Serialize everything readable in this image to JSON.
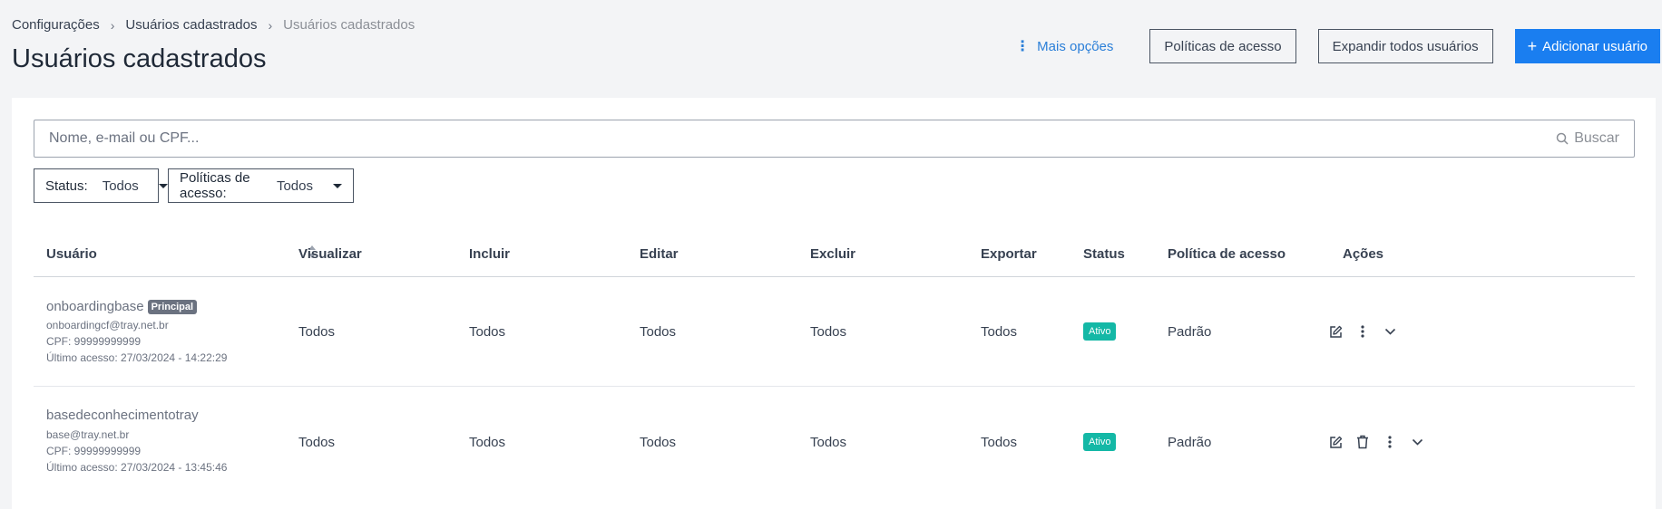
{
  "breadcrumb": {
    "items": [
      "Configurações",
      "Usuários cadastrados"
    ],
    "current": "Usuários cadastrados"
  },
  "page": {
    "title": "Usuários cadastrados"
  },
  "header_actions": {
    "more_options": "Mais opções",
    "access_policies": "Políticas de acesso",
    "expand_all": "Expandir todos usuários",
    "add_user": "Adicionar usuário"
  },
  "search": {
    "placeholder": "Nome, e-mail ou CPF...",
    "button": "Buscar"
  },
  "filters": {
    "status": {
      "label": "Status:",
      "value": "Todos"
    },
    "policy": {
      "label": "Políticas de acesso:",
      "value": "Todos"
    }
  },
  "table": {
    "columns": [
      "Usuário",
      "Visualizar",
      "Incluir",
      "Editar",
      "Excluir",
      "Exportar",
      "Status",
      "Política de acesso",
      "Ações"
    ],
    "rows": [
      {
        "name": "onboardingbase",
        "badge": "Principal",
        "email": "onboardingcf@tray.net.br",
        "cpf": "CPF: 99999999999",
        "last_access": "Último acesso:  27/03/2024 - 14:22:29",
        "view": "Todos",
        "include": "Todos",
        "edit": "Todos",
        "delete": "Todos",
        "export": "Todos",
        "status": "Ativo",
        "policy": "Padrão"
      },
      {
        "name": "basedeconhecimentotray",
        "email": "base@tray.net.br",
        "cpf": "CPF: 99999999999",
        "last_access": "Último acesso:  27/03/2024 - 13:45:46",
        "view": "Todos",
        "include": "Todos",
        "edit": "Todos",
        "delete": "Todos",
        "export": "Todos",
        "status": "Ativo",
        "policy": "Padrão"
      }
    ]
  },
  "colors": {
    "primary": "#1a7ef0",
    "link": "#2b7fd8",
    "status_active": "#14b8a6",
    "badge_principal": "#6b7280",
    "background": "#f3f4f6"
  },
  "icons": [
    "chevron-right-icon",
    "kebab-icon",
    "plus-icon",
    "search-icon",
    "caret-down-icon",
    "sort-icon",
    "edit-icon",
    "trash-icon",
    "chevron-down-icon"
  ]
}
